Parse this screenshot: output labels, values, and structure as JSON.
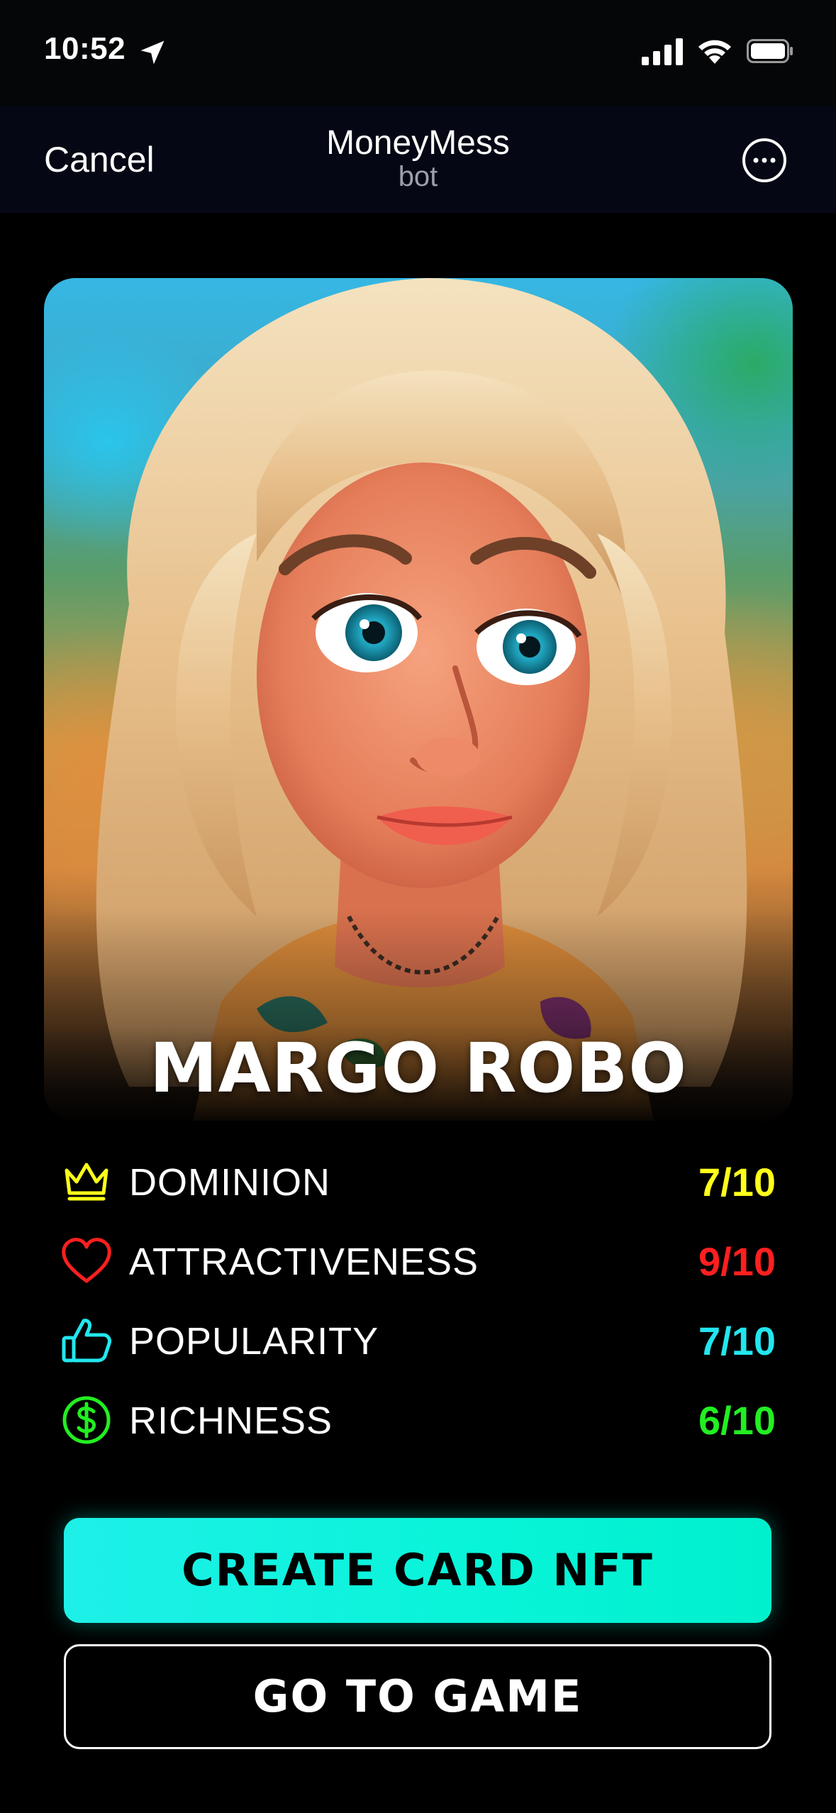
{
  "status_bar": {
    "time": "10:52",
    "icons": [
      "location-arrow-icon",
      "cellular-signal-icon",
      "wifi-icon",
      "battery-icon"
    ]
  },
  "nav": {
    "cancel_label": "Cancel",
    "title": "MoneyMess",
    "subtitle": "bot",
    "more_icon": "ellipsis-circle-icon"
  },
  "card": {
    "name": "MARGO ROBO"
  },
  "stats": [
    {
      "icon": "crown-icon",
      "label": "DOMINION",
      "value": "7/10",
      "color": "#ffff1a"
    },
    {
      "icon": "heart-icon",
      "label": "ATTRACTIVENESS",
      "value": "9/10",
      "color": "#ff1f1f"
    },
    {
      "icon": "thumbs-up-icon",
      "label": "POPULARITY",
      "value": "7/10",
      "color": "#22e6ee"
    },
    {
      "icon": "dollar-coin-icon",
      "label": "RICHNESS",
      "value": "6/10",
      "color": "#22ee22"
    }
  ],
  "buttons": {
    "primary_label": "CREATE CARD NFT",
    "secondary_label": "GO TO GAME"
  },
  "colors": {
    "accent": "#00f0d8",
    "background": "#000000"
  }
}
